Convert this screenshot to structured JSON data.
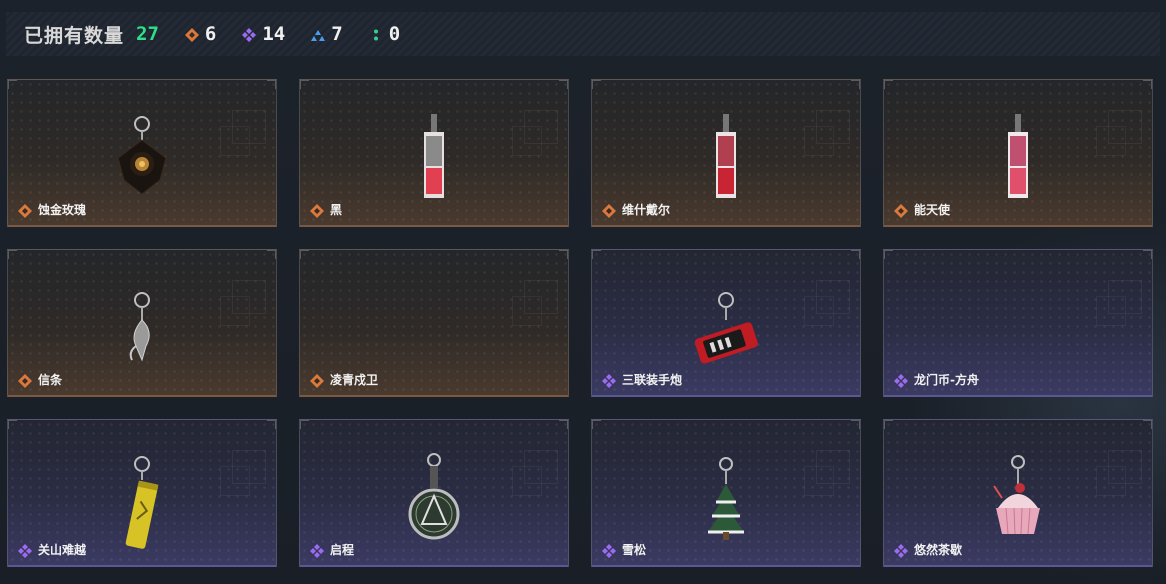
{
  "header": {
    "title": "已拥有数量",
    "total": "27",
    "counts": [
      {
        "icon": "orange-diamond-icon",
        "value": "6",
        "color": "#d9793e"
      },
      {
        "icon": "purple-diamond-icon",
        "value": "14",
        "color": "#9b6cf0"
      },
      {
        "icon": "blue-triangle-icon",
        "value": "7",
        "color": "#4a9de8"
      },
      {
        "icon": "green-dots-icon",
        "value": "0",
        "color": "#2fd48c"
      }
    ]
  },
  "colors": {
    "accent_green": "#2de08a",
    "gold_rarity": "#d9793e",
    "purple_rarity": "#9b6cf0"
  },
  "items": [
    {
      "name": "蚀金玫瑰",
      "rarity": "gold",
      "art": "rose-charm"
    },
    {
      "name": "黑",
      "rarity": "gold",
      "art": "card-charm"
    },
    {
      "name": "维什戴尔",
      "rarity": "gold",
      "art": "card-charm"
    },
    {
      "name": "能天使",
      "rarity": "gold",
      "art": "card-charm"
    },
    {
      "name": "信条",
      "rarity": "gold",
      "art": "silver-charm"
    },
    {
      "name": "凌青戍卫",
      "rarity": "gold",
      "art": "empty"
    },
    {
      "name": "三联装手炮",
      "rarity": "purple",
      "art": "cannon-charm"
    },
    {
      "name": "龙门币-方舟",
      "rarity": "purple",
      "art": "empty"
    },
    {
      "name": "关山难越",
      "rarity": "purple",
      "art": "can-charm"
    },
    {
      "name": "启程",
      "rarity": "purple",
      "art": "medal-charm"
    },
    {
      "name": "雪松",
      "rarity": "purple",
      "art": "tree-charm"
    },
    {
      "name": "悠然茶歇",
      "rarity": "purple",
      "art": "cupcake-charm"
    }
  ]
}
